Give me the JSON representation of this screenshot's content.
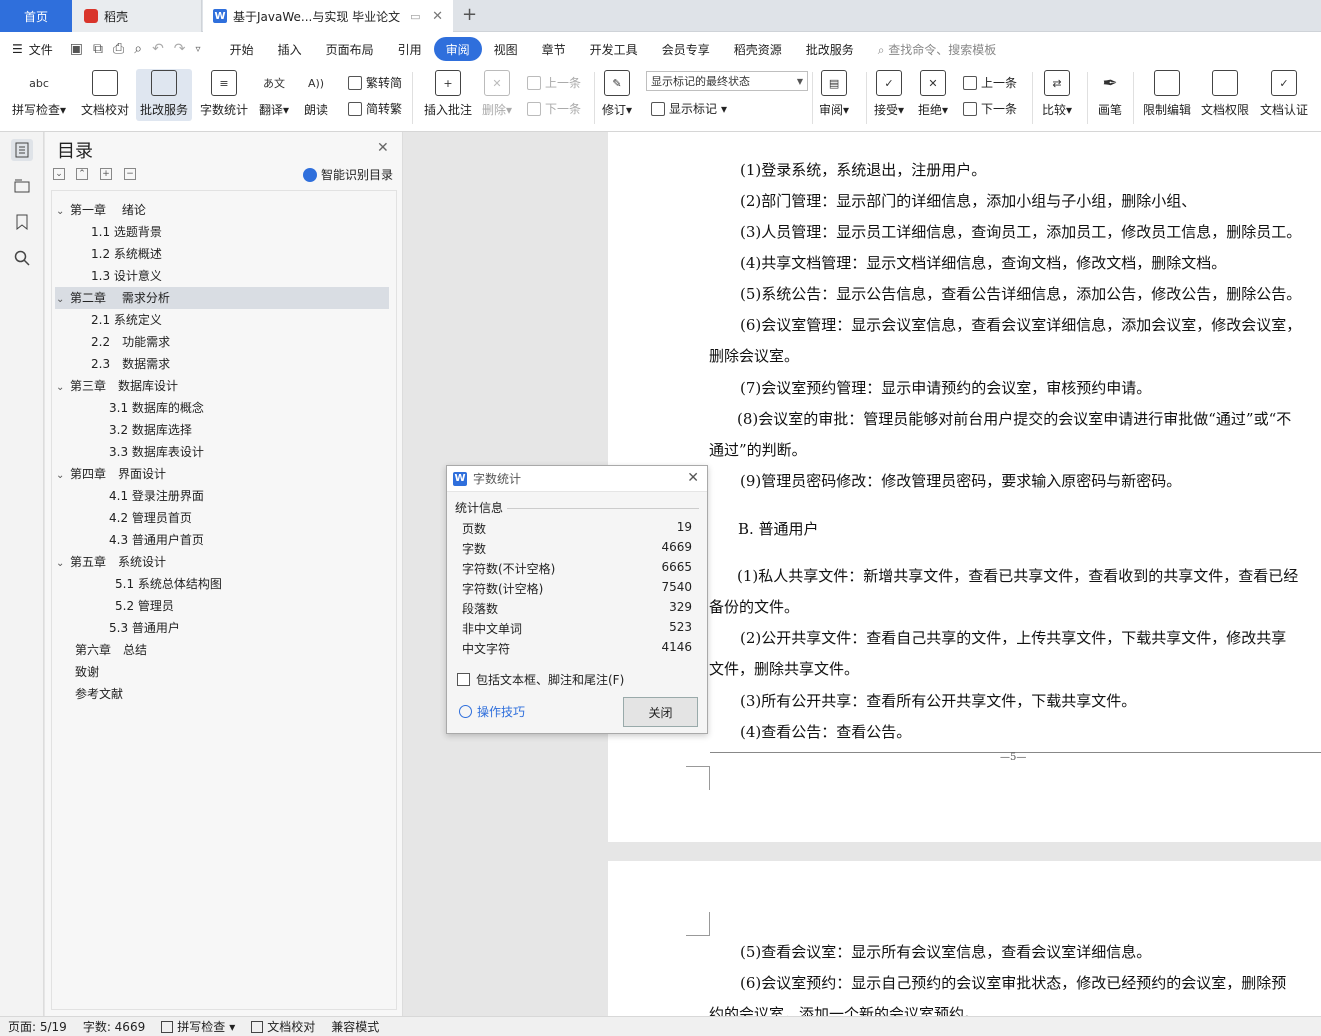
{
  "tabs": {
    "home": "首页",
    "daoke": "稻壳",
    "doc_title": "基于JavaWe...与实现 毕业论文",
    "plus": "+"
  },
  "menu": {
    "file": "文件",
    "items": [
      "开始",
      "插入",
      "页面布局",
      "引用",
      "审阅",
      "视图",
      "章节",
      "开发工具",
      "会员专享",
      "稻壳资源",
      "批改服务"
    ],
    "active": "审阅",
    "search": "查找命令、搜索模板"
  },
  "ribbon": {
    "spell_check": "拼写检查",
    "doc_proof": "文档校对",
    "review_service": "批改服务",
    "word_count": "字数统计",
    "translate": "翻译",
    "read_aloud": "朗读",
    "trad_to_simp": "繁转简",
    "simp_to_trad": "简转繁",
    "insert_comment": "插入批注",
    "delete": "删除",
    "prev_comment": "上一条",
    "next_comment": "下一条",
    "track_changes": "修订",
    "markup_state": "显示标记的最终状态",
    "show_markup": "显示标记",
    "review": "审阅",
    "accept": "接受",
    "reject": "拒绝",
    "prev_change": "上一条",
    "next_change": "下一条",
    "compare": "比较",
    "pen": "画笔",
    "restrict_edit": "限制编辑",
    "doc_permission": "文档权限",
    "doc_auth": "文档认证",
    "abc": "abc"
  },
  "toc": {
    "title": "目录",
    "smart": "智能识别目录",
    "items": [
      {
        "label": "第一章　 绪论"
      },
      {
        "label": "1.1  选题背景"
      },
      {
        "label": "1.2  系统概述"
      },
      {
        "label": "1.3  设计意义"
      },
      {
        "label": "第二章　 需求分析"
      },
      {
        "label": "2.1  系统定义"
      },
      {
        "label": "2.2　功能需求"
      },
      {
        "label": "2.3　数据需求"
      },
      {
        "label": "第三章　数据库设计"
      },
      {
        "label": "3.1  数据库的概念"
      },
      {
        "label": "3.2  数据库选择"
      },
      {
        "label": "3.3  数据库表设计"
      },
      {
        "label": "第四章　界面设计"
      },
      {
        "label": "4.1  登录注册界面"
      },
      {
        "label": "4.2 管理员首页"
      },
      {
        "label": "4.3  普通用户首页"
      },
      {
        "label": "第五章　系统设计"
      },
      {
        "label": "5.1 系统总体结构图"
      },
      {
        "label": "5.2 管理员"
      },
      {
        "label": "5.3 普通用户"
      },
      {
        "label": "第六章　总结"
      },
      {
        "label": "致谢"
      },
      {
        "label": "参考文献"
      }
    ]
  },
  "document": {
    "lines": [
      "(1)登录系统，系统退出，注册用户。",
      "(2)部门管理：显示部门的详细信息，添加小组与子小组，删除小组、",
      "(3)人员管理：显示员工详细信息，查询员工，添加员工，修改员工信息，删除员工。",
      "(4)共享文档管理：显示文档详细信息，查询文档，修改文档，删除文档。",
      "(5)系统公告：显示公告信息，查看公告详细信息，添加公告，修改公告，删除公告。",
      "(6)会议室管理：显示会议室信息，查看会议室详细信息，添加会议室，修改会议室，",
      "删除会议室。",
      "(7)会议室预约管理：显示申请预约的会议室，审核预约申请。",
      "(8)会议室的审批：管理员能够对前台用户提交的会议室申请进行审批做“通过”或“不",
      "通过”的判断。",
      "(9)管理员密码修改：修改管理员密码，要求输入原密码与新密码。",
      "B.  普通用户",
      "(1)私人共享文件：新增共享文件，查看已共享文件，查看收到的共享文件，查看已经",
      "备份的文件。",
      "(2)公开共享文件：查看自己共享的文件，上传共享文件，下载共享文件，修改共享",
      "文件，删除共享文件。",
      "(3)所有公开共享：查看所有公开共享文件，下载共享文件。",
      "(4)查看公告：查看公告。"
    ],
    "page_number": "—5—",
    "page2_lines": [
      "(5)查看会议室：显示所有会议室信息，查看会议室详细信息。",
      "(6)会议室预约：显示自己预约的会议室审批状态，修改已经预约的会议室，删除预",
      "约的会议室，添加一个新的会议室预约。"
    ]
  },
  "dialog": {
    "title": "字数统计",
    "group": "统计信息",
    "stats": [
      {
        "label": "页数",
        "value": "19"
      },
      {
        "label": "字数",
        "value": "4669"
      },
      {
        "label": "字符数(不计空格)",
        "value": "6665"
      },
      {
        "label": "字符数(计空格)",
        "value": "7540"
      },
      {
        "label": "段落数",
        "value": "329"
      },
      {
        "label": "非中文单词",
        "value": "523"
      },
      {
        "label": "中文字符",
        "value": "4146"
      }
    ],
    "include_label": "包括文本框、脚注和尾注(F)",
    "include_checked": false,
    "tips": "操作技巧",
    "close": "关闭"
  },
  "status": {
    "page": "页面: 5/19",
    "words": "字数: 4669",
    "spell": "拼写检查",
    "proof": "文档校对",
    "compat": "兼容模式"
  },
  "colors": {
    "accent": "#2f6fdc",
    "brand_red": "#d9352b"
  }
}
